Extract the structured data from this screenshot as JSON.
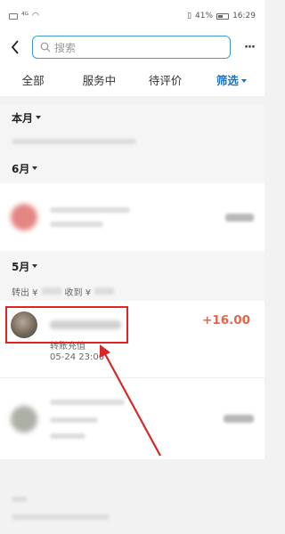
{
  "status_bar": {
    "battery": "41%",
    "time": "16:29"
  },
  "search": {
    "placeholder": "搜索"
  },
  "tabs": [
    {
      "label": "全部"
    },
    {
      "label": "服务中"
    },
    {
      "label": "待评价"
    },
    {
      "label": "筛选"
    }
  ],
  "sections": {
    "current_month": "本月",
    "june": "6月",
    "may": "5月"
  },
  "may_totals": {
    "out_label": "转出 ¥",
    "in_label": "收到 ¥"
  },
  "transaction": {
    "amount": "+16.00",
    "description": "转账充值",
    "date": "05-24  23:00"
  },
  "colors": {
    "accent": "#1a73c6",
    "amount": "#e2664b",
    "highlight": "#e02424"
  }
}
